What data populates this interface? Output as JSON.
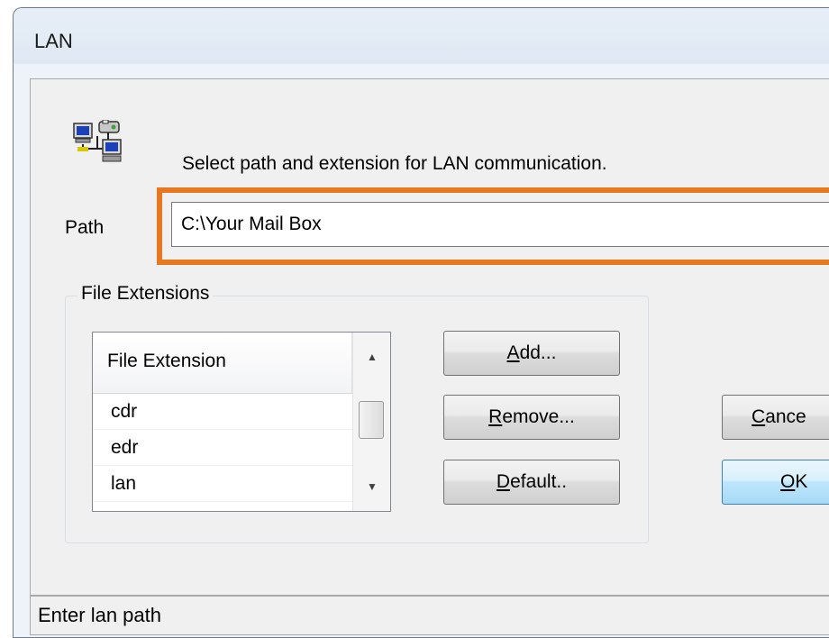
{
  "window": {
    "title": "LAN"
  },
  "dialog": {
    "icon": "network-computers-icon",
    "description": "Select path and extension for LAN communication.",
    "path_label": "Path",
    "path_value": "C:\\Your Mail Box",
    "highlight_color": "#e87722"
  },
  "file_extensions": {
    "group_title": "File Extensions",
    "column_header": "File Extension",
    "items": [
      "cdr",
      "edr",
      "lan"
    ]
  },
  "buttons": {
    "add": {
      "label": "Add...",
      "mnemonic": "A"
    },
    "remove": {
      "label": "Remove...",
      "mnemonic": "R"
    },
    "default": {
      "label": "Default..",
      "mnemonic": "D"
    },
    "cancel": {
      "label": "Cance",
      "mnemonic": "C"
    },
    "ok": {
      "label": "OK",
      "mnemonic": "O"
    }
  },
  "status": {
    "text": "Enter lan path"
  }
}
